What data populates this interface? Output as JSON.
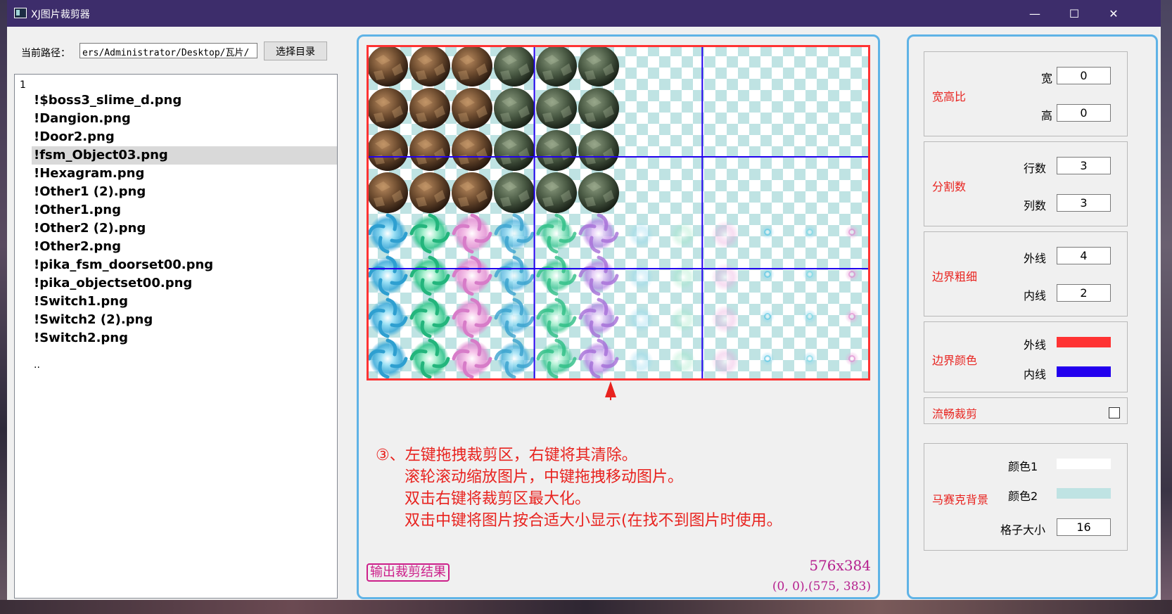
{
  "window": {
    "title": "XJ图片裁剪器"
  },
  "titlebar": {
    "minimize": "—",
    "maximize": "☐",
    "close": "✕"
  },
  "path_bar": {
    "label": "当前路径：",
    "value": "ers/Administrator/Desktop/瓦片/",
    "choose_button": "选择目录"
  },
  "file_list": {
    "header": "1",
    "items": [
      "!$boss3_slime_d.png",
      "!Dangion.png",
      "!Door2.png",
      "!fsm_Object03.png",
      "!Hexagram.png",
      "!Other1 (2).png",
      "!Other1.png",
      "!Other2 (2).png",
      "!Other2.png",
      "!pika_fsm_doorset00.png",
      "!pika_objectset00.png",
      "!Switch1.png",
      "!Switch2 (2).png",
      "!Switch2.png"
    ],
    "selected_item": "!fsm_Object03.png",
    "tail": ".."
  },
  "preview": {
    "instructions": [
      "③、左键拖拽裁剪区，右键将其清除。",
      "滚轮滚动缩放图片，中键拖拽移动图片。",
      "双击右键将裁剪区最大化。",
      "双击中键将图片按合适大小显示(在找不到图片时使用。"
    ],
    "output_button": "输出裁剪结果",
    "image_size": "576x384",
    "selection_coords": "(0, 0),(575, 383)",
    "outer_line_color": "#ff3333",
    "inner_line_color": "#2200ee",
    "arrow_color": "#e8231f"
  },
  "settings": {
    "aspect": {
      "title": "宽高比",
      "width_label": "宽",
      "width": "0",
      "height_label": "高",
      "height": "0"
    },
    "split": {
      "title": "分割数",
      "rows_label": "行数",
      "rows": "3",
      "cols_label": "列数",
      "cols": "3"
    },
    "border_width": {
      "title": "边界粗细",
      "outer_label": "外线",
      "outer": "4",
      "inner_label": "内线",
      "inner": "2"
    },
    "border_color": {
      "title": "边界颜色",
      "outer_label": "外线",
      "outer_color": "#ff3333",
      "inner_label": "内线",
      "inner_color": "#2200ee"
    },
    "smooth_crop": {
      "title": "流畅裁剪",
      "checked": false
    },
    "mosaic": {
      "title": "马赛克背景",
      "color1_label": "颜色1",
      "color1": "#ffffff",
      "color2_label": "颜色2",
      "color2": "#bfe3e3",
      "cell_size_label": "格子大小",
      "cell_size": "16"
    }
  }
}
